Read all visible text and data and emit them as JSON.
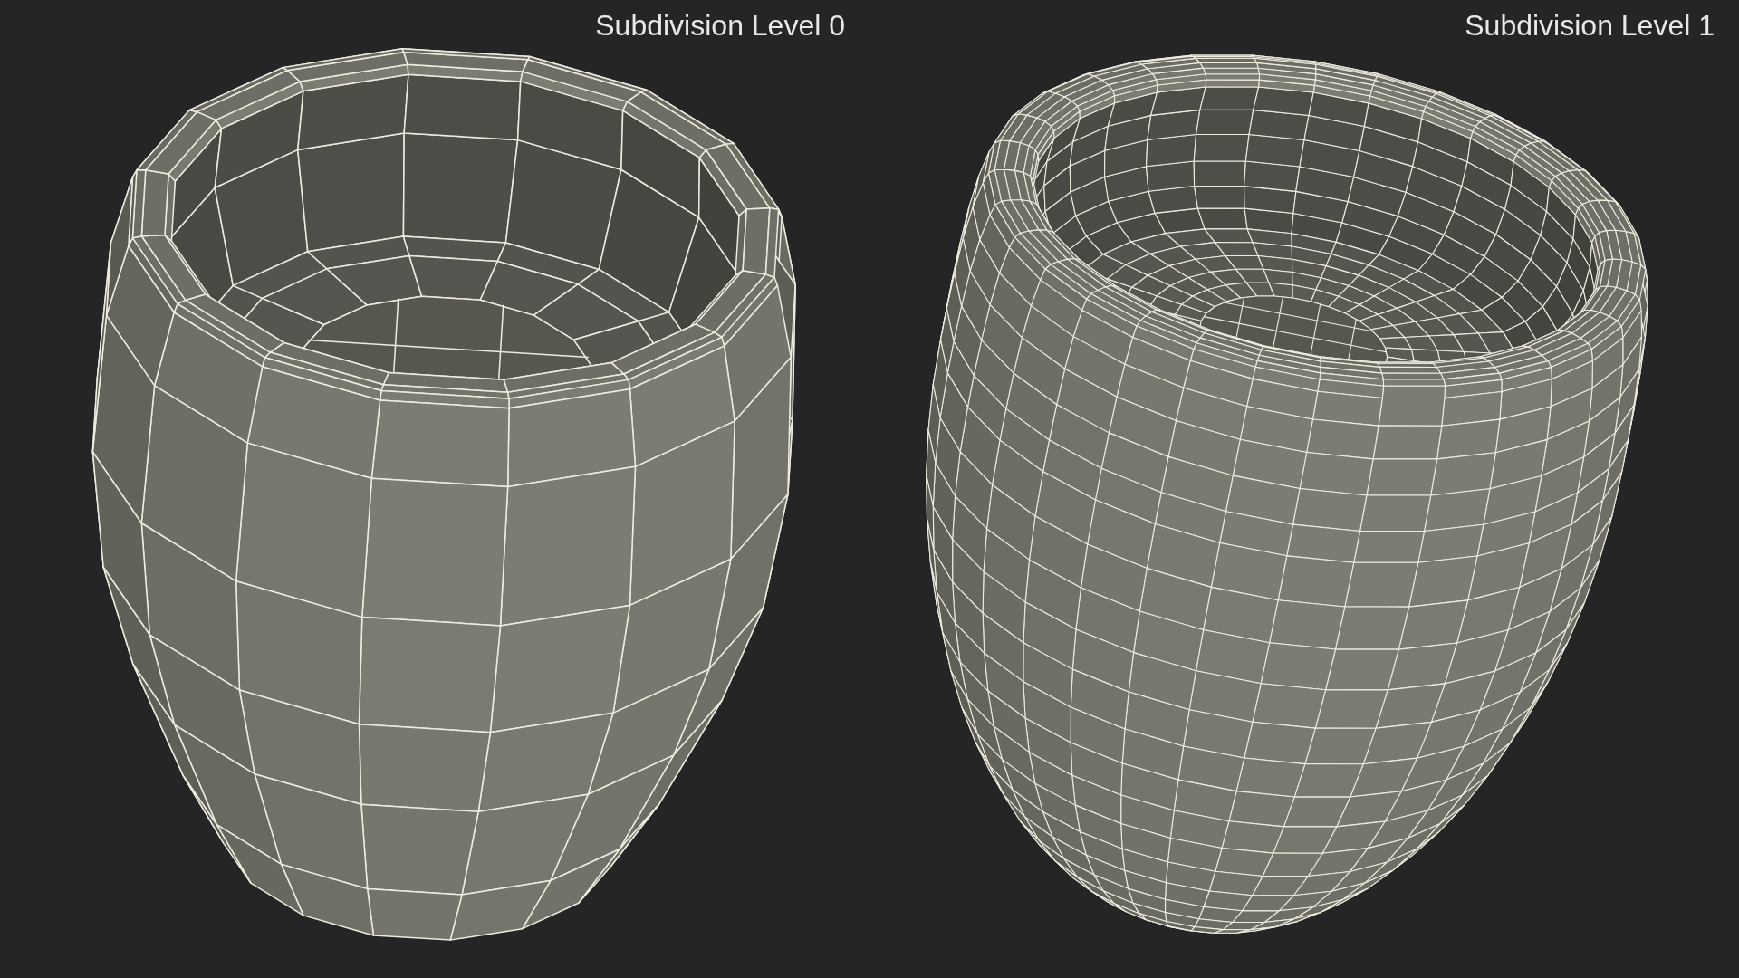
{
  "panels": [
    {
      "label": "Subdivision Level 0",
      "kind": "coarse"
    },
    {
      "label": "Subdivision Level 1",
      "kind": "fine"
    }
  ]
}
